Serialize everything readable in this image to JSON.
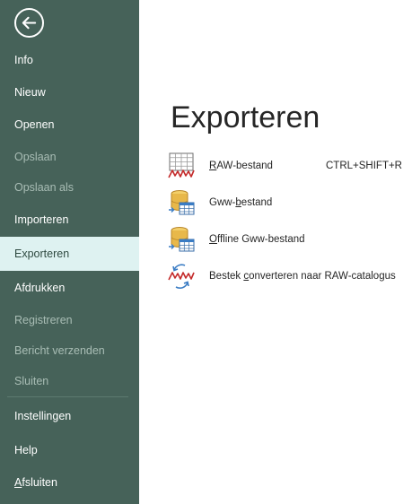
{
  "sidebar": {
    "items": [
      {
        "label": "Info",
        "state": "normal"
      },
      {
        "label": "Nieuw",
        "state": "normal"
      },
      {
        "label": "Openen",
        "state": "normal"
      },
      {
        "label": "Opslaan",
        "state": "disabled"
      },
      {
        "label": "Opslaan als",
        "state": "disabled"
      },
      {
        "label": "Importeren",
        "state": "normal"
      },
      {
        "label": "Exporteren",
        "state": "active"
      },
      {
        "label": "Afdrukken",
        "state": "normal"
      },
      {
        "label": "Registreren",
        "state": "disabled"
      },
      {
        "label": "Bericht verzenden",
        "state": "disabled"
      },
      {
        "label": "Sluiten",
        "state": "disabled"
      },
      {
        "label": "Instellingen",
        "state": "normal"
      },
      {
        "label": "Help",
        "state": "normal"
      },
      {
        "label": "Afsluiten",
        "state": "normal",
        "mnemonic": "A",
        "rest": "fsluiten"
      }
    ]
  },
  "main": {
    "title": "Exporteren",
    "commands": [
      {
        "icon": "raw-grid-icon",
        "mnemonic": "R",
        "rest": "AW-bestand",
        "label": "RAW-bestand",
        "shortcut": "CTRL+SHIFT+R"
      },
      {
        "icon": "database-table-icon",
        "before": "Gww-",
        "mnemonic": "b",
        "rest": "estand",
        "label": "Gww-bestand",
        "shortcut": ""
      },
      {
        "icon": "database-table-icon",
        "mnemonic": "O",
        "rest": "ffline Gww-bestand",
        "label": "Offline Gww-bestand",
        "shortcut": ""
      },
      {
        "icon": "raw-convert-icon",
        "before": "Bestek ",
        "mnemonic": "c",
        "rest": "onverteren naar RAW-catalogus",
        "label": "Bestek converteren naar RAW-catalogus",
        "shortcut": ""
      }
    ]
  },
  "colors": {
    "sidebar_bg": "#466259",
    "active_item_bg": "#def2f1",
    "disabled_text": "#a9bdb5",
    "raw_red": "#c42b2b",
    "db_yellow": "#e8b84a",
    "arrow_blue": "#3a7cc4"
  }
}
